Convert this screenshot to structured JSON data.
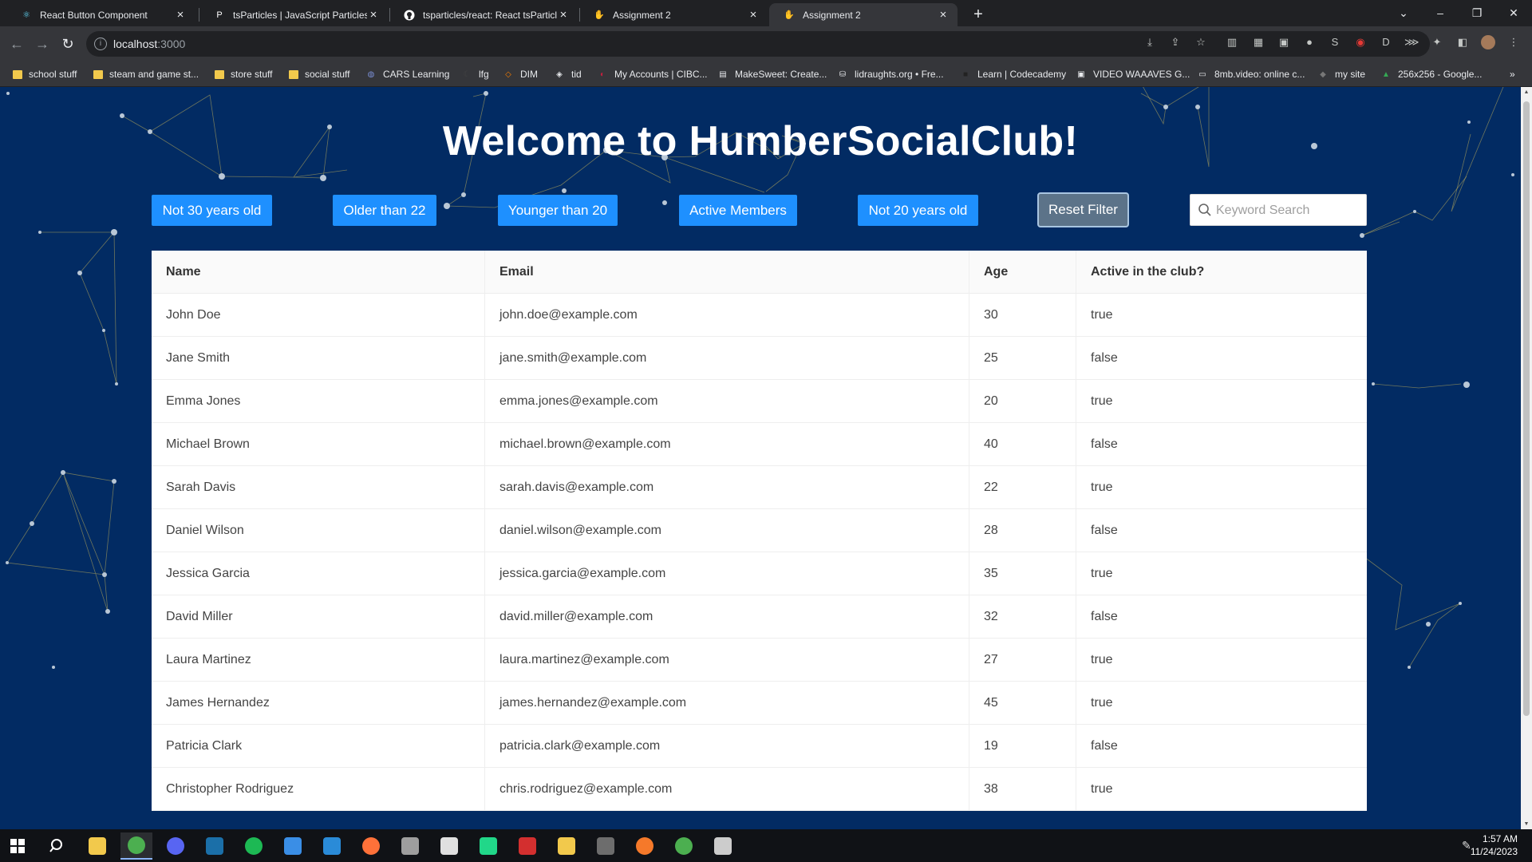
{
  "browser": {
    "tabs": [
      {
        "title": "React Button Component",
        "icon": "react-icon",
        "color": "#61dafb"
      },
      {
        "title": "tsParticles | JavaScript Particles, C",
        "icon": "tsparticles-icon",
        "color": "#ffffff"
      },
      {
        "title": "tsparticles/react: React tsParticle",
        "icon": "github-icon",
        "color": "#ffffff"
      },
      {
        "title": "Assignment 2",
        "icon": "react-app-icon",
        "color": "#f7df1e"
      },
      {
        "title": "Assignment 2",
        "icon": "react-app-icon",
        "color": "#f7df1e",
        "active": true
      }
    ],
    "url_host": "localhost",
    "url_port": ":3000",
    "bookmarks": [
      {
        "label": "school stuff",
        "icon": "folder-icon"
      },
      {
        "label": "steam and game st...",
        "icon": "folder-icon"
      },
      {
        "label": "store stuff",
        "icon": "folder-icon"
      },
      {
        "label": "social stuff",
        "icon": "folder-icon"
      },
      {
        "label": "CARS Learning",
        "icon": "globe-icon"
      },
      {
        "label": "lfg",
        "icon": "moon-icon"
      },
      {
        "label": "DIM",
        "icon": "diamond-icon"
      },
      {
        "label": "tid",
        "icon": "diamond-outline-icon"
      },
      {
        "label": "My Accounts | CIBC...",
        "icon": "cibc-icon"
      },
      {
        "label": "MakeSweet: Create...",
        "icon": "makesweet-icon"
      },
      {
        "label": "lidraughts.org • Fre...",
        "icon": "lidraughts-icon"
      },
      {
        "label": "Learn | Codecademy",
        "icon": "codecademy-icon"
      },
      {
        "label": "VIDEO WAAAVES G...",
        "icon": "video-icon"
      },
      {
        "label": "8mb.video: online c...",
        "icon": "8mb-icon"
      },
      {
        "label": "my site",
        "icon": "site-icon"
      },
      {
        "label": "256x256 - Google...",
        "icon": "drive-icon"
      }
    ]
  },
  "page": {
    "title": "Welcome to HumberSocialClub!",
    "filters": [
      "Not 30 years old",
      "Older than 22",
      "Younger than 20",
      "Active Members",
      "Not 20 years old"
    ],
    "reset_label": "Reset Filter",
    "search_placeholder": "Keyword Search",
    "table": {
      "headers": [
        "Name",
        "Email",
        "Age",
        "Active in the club?"
      ],
      "rows": [
        [
          "John Doe",
          "john.doe@example.com",
          "30",
          "true"
        ],
        [
          "Jane Smith",
          "jane.smith@example.com",
          "25",
          "false"
        ],
        [
          "Emma Jones",
          "emma.jones@example.com",
          "20",
          "true"
        ],
        [
          "Michael Brown",
          "michael.brown@example.com",
          "40",
          "false"
        ],
        [
          "Sarah Davis",
          "sarah.davis@example.com",
          "22",
          "true"
        ],
        [
          "Daniel Wilson",
          "daniel.wilson@example.com",
          "28",
          "false"
        ],
        [
          "Jessica Garcia",
          "jessica.garcia@example.com",
          "35",
          "true"
        ],
        [
          "David Miller",
          "david.miller@example.com",
          "32",
          "false"
        ],
        [
          "Laura Martinez",
          "laura.martinez@example.com",
          "27",
          "true"
        ],
        [
          "James Hernandez",
          "james.hernandez@example.com",
          "45",
          "true"
        ],
        [
          "Patricia Clark",
          "patricia.clark@example.com",
          "19",
          "false"
        ],
        [
          "Christopher Rodriguez",
          "chris.rodriguez@example.com",
          "38",
          "true"
        ]
      ]
    },
    "colors": {
      "background": "#022b63",
      "button": "#1e90ff",
      "reset": "#5c7389",
      "particle_link": "#c8b45a"
    }
  },
  "taskbar": {
    "apps": [
      {
        "icon": "file-explorer-icon",
        "color": "#f2c94c"
      },
      {
        "icon": "chrome-icon",
        "color": "#4caf50",
        "active": true
      },
      {
        "icon": "discord-icon",
        "color": "#5865f2"
      },
      {
        "icon": "steam-icon",
        "color": "#1b6fa8"
      },
      {
        "icon": "spotify-icon",
        "color": "#1db954"
      },
      {
        "icon": "store-icon",
        "color": "#3a8ee6"
      },
      {
        "icon": "vscode-icon",
        "color": "#2a8bd8"
      },
      {
        "icon": "firefox-icon",
        "color": "#ff7139"
      },
      {
        "icon": "shield-app-icon",
        "color": "#9e9e9e"
      },
      {
        "icon": "no-entry-icon",
        "color": "#e0e0e0"
      },
      {
        "icon": "pycharm-icon",
        "color": "#21d789"
      },
      {
        "icon": "download-app-icon",
        "color": "#d32f2f"
      },
      {
        "icon": "notes-app-icon",
        "color": "#f2c94c"
      },
      {
        "icon": "game-app-icon",
        "color": "#6d6d6d"
      },
      {
        "icon": "blender-icon",
        "color": "#f5792a"
      },
      {
        "icon": "mongodb-icon",
        "color": "#4caf50"
      },
      {
        "icon": "terminal-icon",
        "color": "#cccccc"
      }
    ],
    "time": "1:57 AM",
    "date": "11/24/2023"
  }
}
